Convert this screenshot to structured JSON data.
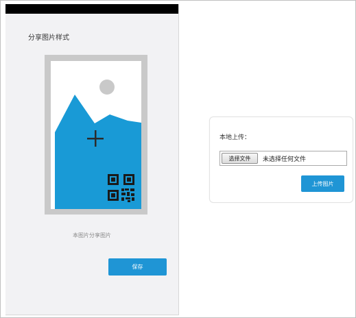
{
  "preview": {
    "title": "分享图片样式",
    "caption": "本图片分享图片",
    "save_label": "保存"
  },
  "upload": {
    "label": "本地上传：",
    "choose_label": "选择文件",
    "file_status": "未选择任何文件",
    "upload_label": "上传图片"
  },
  "colors": {
    "accent": "#1f95d5",
    "image_blue": "#199ad6",
    "frame_gray": "#c9c9c9"
  },
  "icons": {
    "placeholder": "image-placeholder-icon",
    "add": "plus-icon",
    "qr": "qr-code-icon"
  }
}
